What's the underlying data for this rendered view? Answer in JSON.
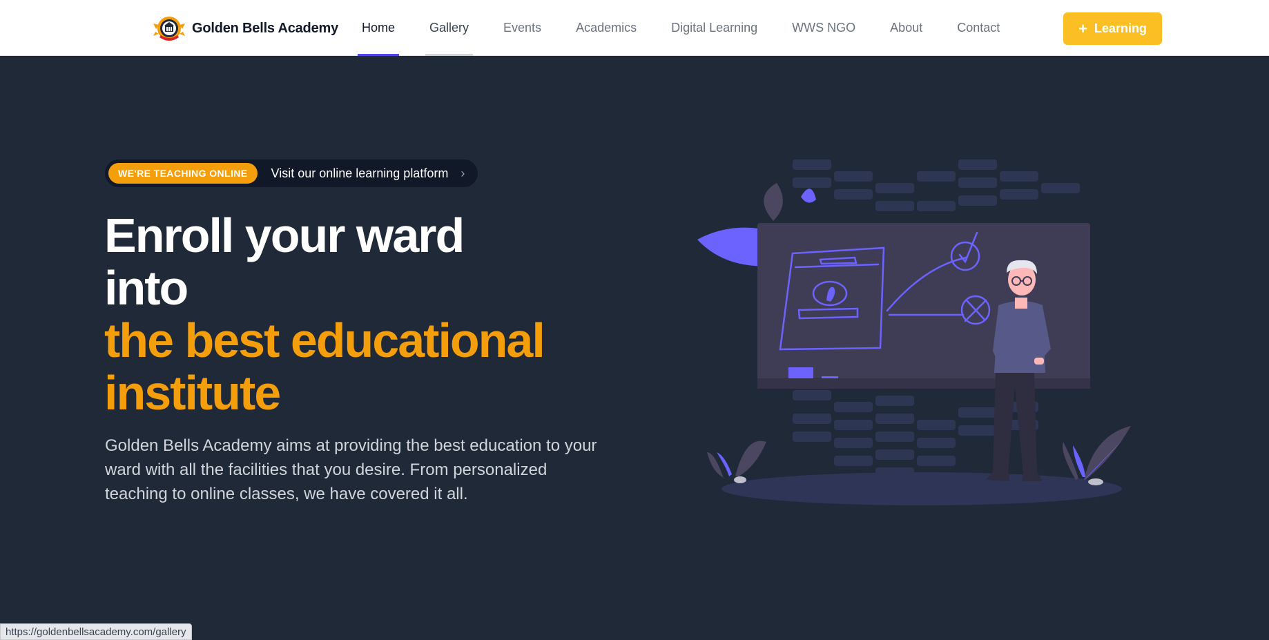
{
  "brand": {
    "name": "Golden Bells Academy",
    "logo_icon": "school-crest-icon"
  },
  "nav": {
    "items": [
      {
        "label": "Home",
        "state": "active"
      },
      {
        "label": "Gallery",
        "state": "hover"
      },
      {
        "label": "Events",
        "state": ""
      },
      {
        "label": "Academics",
        "state": ""
      },
      {
        "label": "Digital Learning",
        "state": ""
      },
      {
        "label": "WWS NGO",
        "state": ""
      },
      {
        "label": "About",
        "state": ""
      },
      {
        "label": "Contact",
        "state": ""
      }
    ],
    "cta_label": "Learning",
    "cta_icon": "plus-icon"
  },
  "hero": {
    "badge": "WE'RE TEACHING ONLINE",
    "pill_text": "Visit our online learning platform",
    "pill_icon": "chevron-right-icon",
    "headline_line1": "Enroll your ward",
    "headline_line2": "into",
    "headline_highlight1": "the best educational",
    "headline_highlight2": "institute",
    "description": "Golden Bells Academy aims at providing the best education to your ward with all the facilities that you desire. From personalized teaching to online classes, we have covered it all.",
    "illustration": "teacher-at-chalkboard-illustration"
  },
  "status_bar": {
    "url": "https://goldenbellsacademy.com/gallery"
  },
  "colors": {
    "background": "#1f2937",
    "accent_gold": "#f59e0b",
    "cta_yellow": "#fbbf24",
    "nav_active": "#4f46e5",
    "illustration_purple": "#6c63ff"
  }
}
